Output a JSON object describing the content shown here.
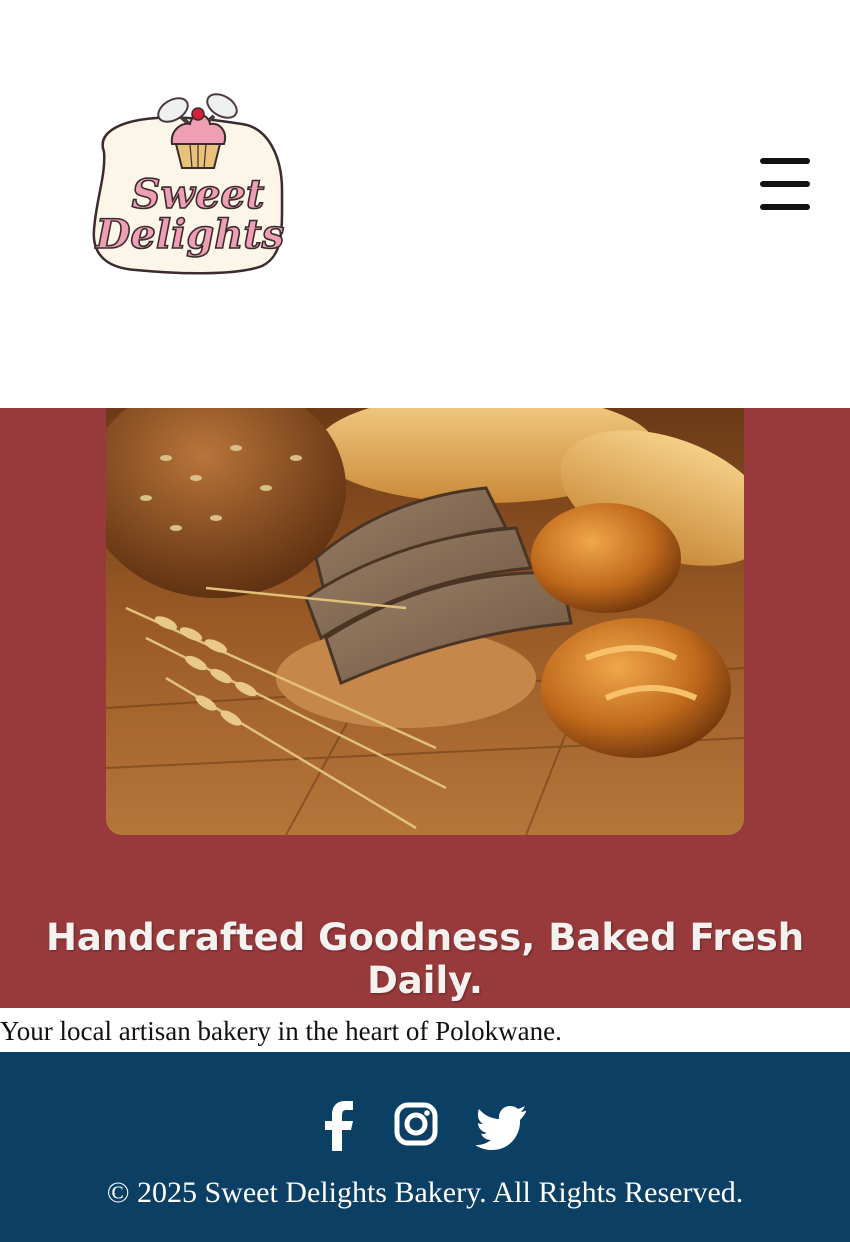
{
  "header": {
    "logo": {
      "line1": "Sweet",
      "line2": "Delights",
      "icon": "cupcake-whisk-icon"
    },
    "menu_icon": "hamburger-menu-icon"
  },
  "hero": {
    "image": "artisan-bread-wheat-photo",
    "headline": "Handcrafted Goodness, Baked Fresh Daily.",
    "tagline": "Your local artisan bakery in the heart of Polokwane."
  },
  "footer": {
    "social": [
      "facebook-icon",
      "instagram-icon",
      "twitter-icon"
    ],
    "copyright": "© 2025 Sweet Delights Bakery. All Rights Reserved."
  },
  "colors": {
    "hero_bg": "#983a3c",
    "footer_bg": "#0b3f64",
    "headline": "#f4f1ef",
    "logo_pink": "#ef9fb4",
    "logo_cream": "#fbf6e8"
  }
}
